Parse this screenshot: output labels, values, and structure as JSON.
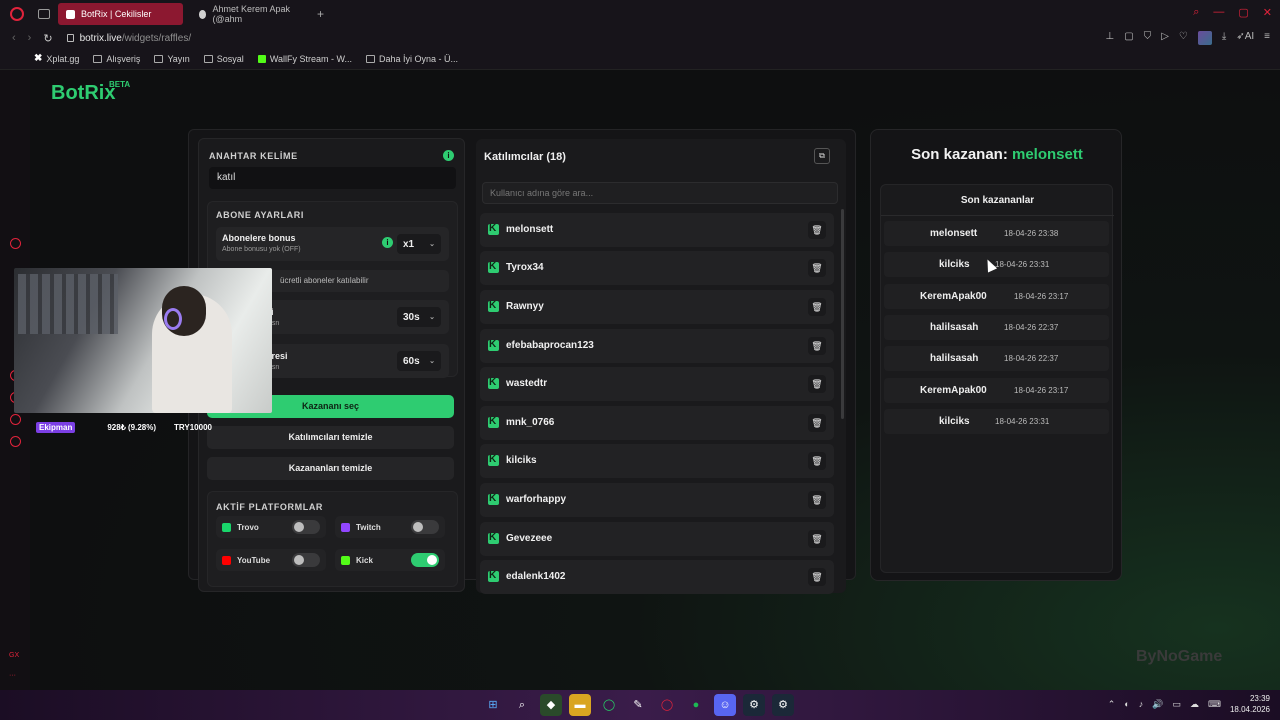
{
  "browser": {
    "tabs": [
      {
        "label": "BotRix | Cekilisler",
        "active": true
      },
      {
        "label": "Ahmet Kerem Apak (@ahm",
        "active": false
      }
    ],
    "new_tab": "+",
    "url_host": "botrix.live",
    "url_path": "/widgets/raffles/",
    "bookmarks": [
      "Xplat.gg",
      "Alışveriş",
      "Yayın",
      "Sosyal",
      "WallFy Stream - W...",
      "Daha İyi Oyna - Ü..."
    ],
    "toolbar_label_ai": "AI"
  },
  "app": {
    "logo": "BotRix",
    "logo_badge": "BETA"
  },
  "keyword": {
    "title": "ANAHTAR KELİME",
    "value": "katıl",
    "info": "i"
  },
  "subscriber": {
    "title": "ABONE AYARLARI",
    "bonus_label": "Abonelere bonus",
    "bonus_desc": "Abone bonusu yok (OFF)",
    "bonus_value": "x1",
    "free_text": "ücretli aboneler katılabilir",
    "time1_label": "si",
    "time1_sub": "0 sn",
    "time1_value": "30s",
    "time2_label": "üresi",
    "time2_sub": "0 sn",
    "time2_value": "60s"
  },
  "actions": {
    "pick_winner": "Kazananı seç",
    "clear_participants": "Katılımcıları temizle",
    "clear_winners": "Kazananları temizle"
  },
  "platforms": {
    "title": "AKTİF PLATFORMLAR",
    "items": [
      {
        "name": "Trovo",
        "enabled": false,
        "color": "#19d66b"
      },
      {
        "name": "Twitch",
        "enabled": false,
        "color": "#9146ff"
      },
      {
        "name": "YouTube",
        "enabled": false,
        "color": "#ff0000"
      },
      {
        "name": "Kick",
        "enabled": true,
        "color": "#53fc18"
      }
    ]
  },
  "participants": {
    "header": "Katılımcılar (18)",
    "search_placeholder": "Kullanıcı adına göre ara...",
    "items": [
      "melonsett",
      "Tyrox34",
      "Rawnyy",
      "efebabaprocan123",
      "wastedtr",
      "mnk_0766",
      "kilciks",
      "warforhappy",
      "Gevezeee",
      "edalenk1402"
    ]
  },
  "winners": {
    "last_label": "Son kazanan:",
    "last_name": "melonsett",
    "list_title": "Son kazananlar",
    "items": [
      {
        "name": "melonsett",
        "time": "18-04-26 23:38"
      },
      {
        "name": "kilciks",
        "time": "18-04-26 23:31"
      },
      {
        "name": "KeremApak00",
        "time": "18-04-26 23:17"
      },
      {
        "name": "halilsasah",
        "time": "18-04-26 22:37"
      },
      {
        "name": "halilsasah",
        "time": "18-04-26 22:37"
      },
      {
        "name": "KeremApak00",
        "time": "18-04-26 23:17"
      },
      {
        "name": "kilciks",
        "time": "18-04-26 23:31"
      }
    ]
  },
  "stream_overlay": {
    "chip": "Ekipman",
    "stat": "928₺ (9.28%)",
    "goal": "TRY10000"
  },
  "watermark": "ByNoGame",
  "sidebar_bottom_text": "GX",
  "clock": {
    "time": "23:39",
    "date": "18.04.2026"
  },
  "colors": {
    "accent": "#2ecc71",
    "opera_red": "#e0233b",
    "tab_active": "#8c1830"
  }
}
